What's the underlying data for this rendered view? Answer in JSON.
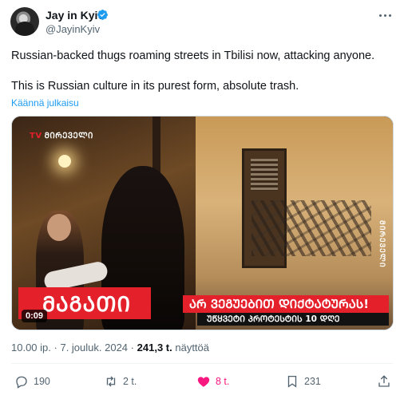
{
  "author": {
    "display_name": "Jay in Kyiv",
    "handle": "@JayinKyiv",
    "verified": true
  },
  "tweet": {
    "line1": "Russian-backed thugs roaming streets in Tbilisi now, attacking anyone.",
    "line2": "This is Russian culture in its purest form, absolute trash.",
    "translate_label": "Käännä julkaisu"
  },
  "media": {
    "channel_logo": "ᲛᲘᲠᲔᲕᲔᲚᲘ",
    "channel_prefix": "TV",
    "live_text": "ᲛᲐᲒᲐᲗᲘ",
    "headline": "ᲐᲠ ᲕᲔᲒᲣᲔᲑᲘᲗ ᲓᲘᲥᲢᲐᲢᲣᲠᲐᲡ!",
    "subheadline": "ᲣᲬᲧᲕᲔᲢᲘ ᲞᲠᲝᲢᲔᲡᲢᲘᲡ 10 ᲓᲦᲔ",
    "side_ticker": "ᲛᲘᲠᲔᲕᲔᲚᲘ",
    "duration": "0:09",
    "brand_red": "#e4202b"
  },
  "meta": {
    "time": "10.00 ip.",
    "separator": "·",
    "date": "7. jouluk. 2024",
    "views_count": "241,3 t.",
    "views_label": "näyttöä"
  },
  "actions": {
    "reply_count": "190",
    "retweet_count": "2 t.",
    "like_count": "8 t.",
    "bookmark_count": "231",
    "like_color": "#f91880"
  }
}
